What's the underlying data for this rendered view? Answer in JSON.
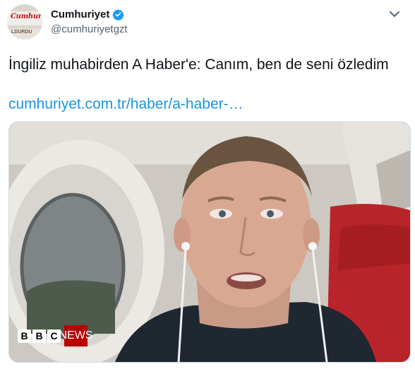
{
  "account": {
    "name": "Cumhuriyet",
    "handle": "@cumhuriyetgzt",
    "avatar_logo": "Cumhuriyet",
    "avatar_strip": "LDURDU",
    "verified_color": "#1d9bf0"
  },
  "tweet": {
    "text": "İngiliz muhabirden A Haber'e: Canım, ben de seni özledim",
    "link": "cumhuriyet.com.tr/haber/a-haber-…",
    "link_color": "#1b95e0"
  },
  "media": {
    "logo_letters": [
      "B",
      "B",
      "C"
    ],
    "logo_word": "NEWS",
    "logo_color": "#b80000"
  },
  "icons": {
    "verified": "verified-badge-icon",
    "more": "chevron-down-icon"
  }
}
